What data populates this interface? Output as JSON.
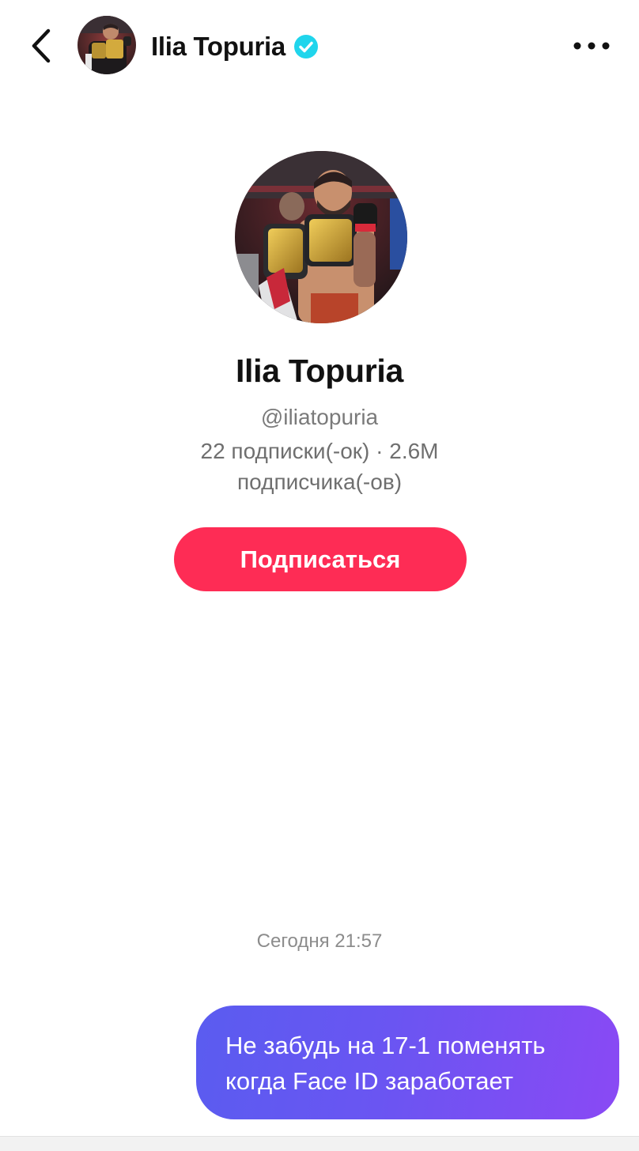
{
  "header": {
    "name": "Ilia Topuria",
    "back_icon": "chevron-left-icon",
    "verified_icon": "verified-check-icon",
    "more_icon": "more-horizontal-icon",
    "avatar": "profile-photo"
  },
  "profile": {
    "name": "Ilia Topuria",
    "handle": "@iliatopuria",
    "stats_line1": "22 подписки(-ок) · 2.6M",
    "stats_line2": "подписчика(-ов)",
    "follow_label": "Подписаться"
  },
  "chat": {
    "timestamp": "Сегодня 21:57",
    "message": {
      "line1": "Не забудь на 17-1 поменять",
      "line2": "когда Face ID заработает"
    }
  },
  "colors": {
    "accent": "#fe2c55",
    "bubble_start": "#5a5cf0",
    "bubble_end": "#8a49f4",
    "verified": "#20d5ec"
  }
}
